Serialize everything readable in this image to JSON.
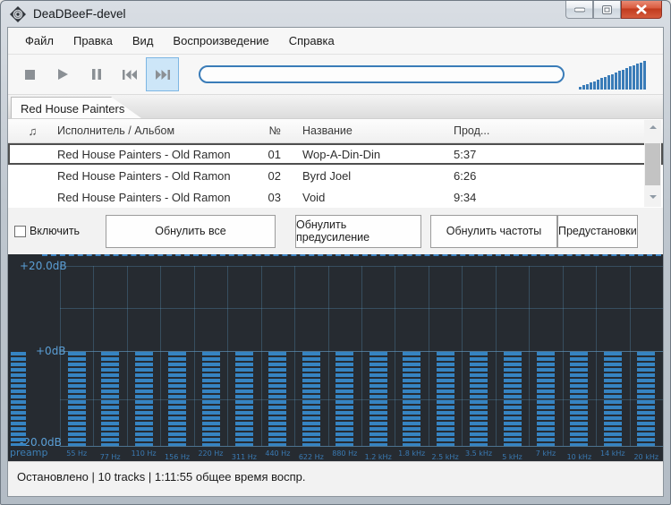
{
  "window": {
    "title": "DeaDBeeF-devel",
    "controls": [
      {
        "name": "minimize",
        "icon": "minimize-icon"
      },
      {
        "name": "maximize",
        "icon": "maximize-icon"
      },
      {
        "name": "close",
        "icon": "close-icon"
      }
    ]
  },
  "menu": {
    "items": [
      "Файл",
      "Правка",
      "Вид",
      "Воспроизведение",
      "Справка"
    ]
  },
  "toolbar": {
    "buttons": [
      {
        "name": "stop",
        "icon": "stop-icon",
        "active": false
      },
      {
        "name": "play",
        "icon": "play-icon",
        "active": false
      },
      {
        "name": "pause",
        "icon": "pause-icon",
        "active": false
      },
      {
        "name": "previous",
        "icon": "previous-track-icon",
        "active": false
      },
      {
        "name": "next",
        "icon": "next-track-icon",
        "active": true
      }
    ],
    "seekbar_value": 0,
    "volume_bar_count": 19,
    "accent_color": "#3a7cb8"
  },
  "tabs": [
    {
      "label": "Red House Painters",
      "active": true
    }
  ],
  "playlist": {
    "columns": {
      "icon": "♫",
      "artist_album": "Исполнитель / Альбом",
      "number": "№",
      "title": "Название",
      "duration": "Прод..."
    },
    "rows": [
      {
        "artist_album": "Red House Painters - Old Ramon",
        "number": "01",
        "title": "Wop-A-Din-Din",
        "duration": "5:37",
        "selected": true
      },
      {
        "artist_album": "Red House Painters - Old Ramon",
        "number": "02",
        "title": "Byrd Joel",
        "duration": "6:26",
        "selected": false
      },
      {
        "artist_album": "Red House Painters - Old Ramon",
        "number": "03",
        "title": "Void",
        "duration": "9:34",
        "selected": false
      }
    ]
  },
  "equalizer": {
    "enable_label": "Включить",
    "enabled": false,
    "buttons": [
      "Обнулить все",
      "Обнулить предусиление",
      "Обнулить частоты",
      "Предустановки"
    ],
    "scale": {
      "top": "+20.0dB",
      "mid": "+0dB",
      "bottom": "-20.0dB",
      "range_db": [
        -20,
        20
      ]
    },
    "preamp_label": "preamp",
    "preamp_db": 0,
    "bands": [
      "55 Hz",
      "77 Hz",
      "110 Hz",
      "156 Hz",
      "220 Hz",
      "311 Hz",
      "440 Hz",
      "622 Hz",
      "880 Hz",
      "1.2 kHz",
      "1.8 kHz",
      "2.5 kHz",
      "3.5 kHz",
      "5 kHz",
      "7 kHz",
      "10 kHz",
      "14 kHz",
      "20 kHz"
    ],
    "band_values_db": [
      0,
      0,
      0,
      0,
      0,
      0,
      0,
      0,
      0,
      0,
      0,
      0,
      0,
      0,
      0,
      0,
      0,
      0
    ],
    "colors": {
      "background": "#262b31",
      "bar": "#3684c2",
      "grid": "#5c98c2",
      "label": "#3a7ab3",
      "scale_label": "#5b9fd6"
    }
  },
  "statusbar": {
    "text": "Остановлено | 10 tracks | 1:11:55 общее время воспр."
  }
}
